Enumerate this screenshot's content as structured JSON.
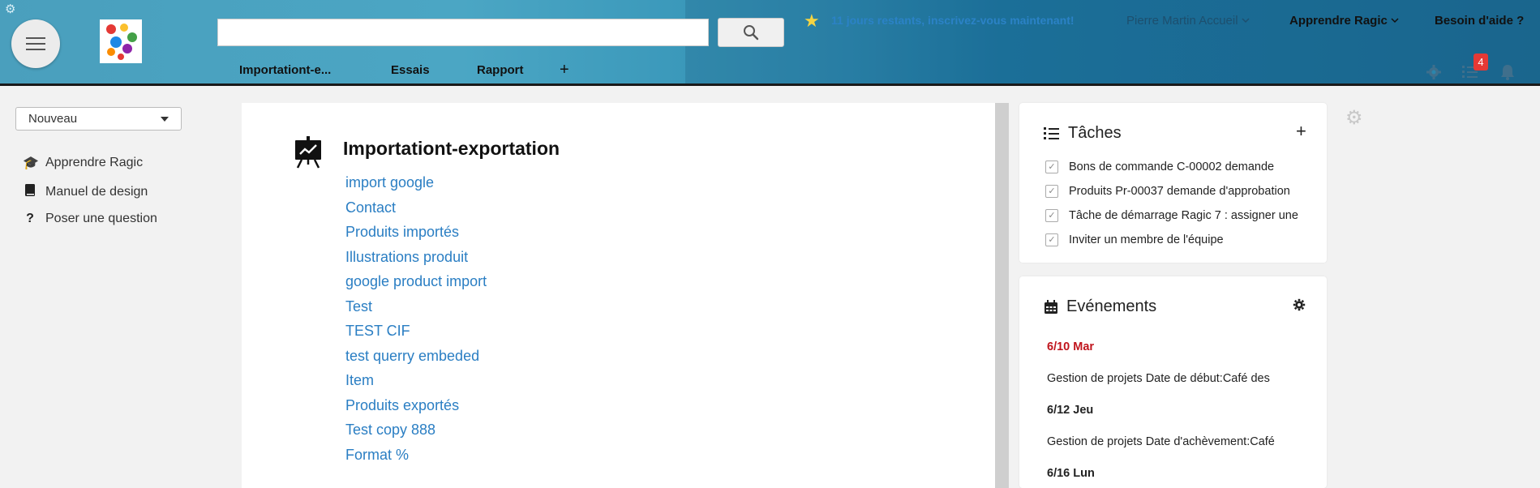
{
  "header": {
    "search": {
      "placeholder": "",
      "value": ""
    },
    "trial_text": "11 jours restants, inscrivez-vous maintenant!",
    "user_menu": "Pierre Martin Accueil",
    "learn_menu": "Apprendre Ragic",
    "help_link": "Besoin d'aide ?",
    "tabs": [
      {
        "label": "Importationt-e..."
      },
      {
        "label": "Essais"
      },
      {
        "label": "Rapport"
      }
    ],
    "add_tab": "+",
    "notification_badge": "4",
    "colors": {
      "header_start": "#4a9fbd",
      "header_end": "#1e6f97",
      "trial": "#2b82c6",
      "badge": "#e53935"
    }
  },
  "sidebar": {
    "new_select": "Nouveau",
    "items": [
      {
        "label": "Apprendre Ragic",
        "icon": "graduation-cap-icon"
      },
      {
        "label": "Manuel de design",
        "icon": "book-icon"
      },
      {
        "label": "Poser une question",
        "icon": "question-icon"
      }
    ]
  },
  "main": {
    "title": "Importationt-exportation",
    "links": [
      "import google",
      "Contact",
      "Produits importés",
      "Illustrations produit",
      "google product import",
      "Test",
      "TEST CIF",
      "test querry embeded",
      "Item",
      "Produits exportés",
      "Test copy 888",
      "Format %"
    ],
    "link_color": "#2a7ec3"
  },
  "tasks": {
    "title": "Tâches",
    "add": "+",
    "items": [
      "Bons de commande C-00002 demande",
      "Produits Pr-00037 demande d'approbation",
      "Tâche de démarrage Ragic 7 : assigner une",
      "Inviter un membre de l'équipe"
    ]
  },
  "events": {
    "title": "Evénements",
    "entries": [
      {
        "text": "6/10 Mar",
        "kind": "date-today"
      },
      {
        "text": "Gestion de projets Date de début:Café des",
        "kind": "event"
      },
      {
        "text": "6/12 Jeu",
        "kind": "date"
      },
      {
        "text": "Gestion de projets Date d'achèvement:Café",
        "kind": "event"
      },
      {
        "text": "6/16 Lun",
        "kind": "date"
      }
    ],
    "today_color": "#c0141c"
  }
}
